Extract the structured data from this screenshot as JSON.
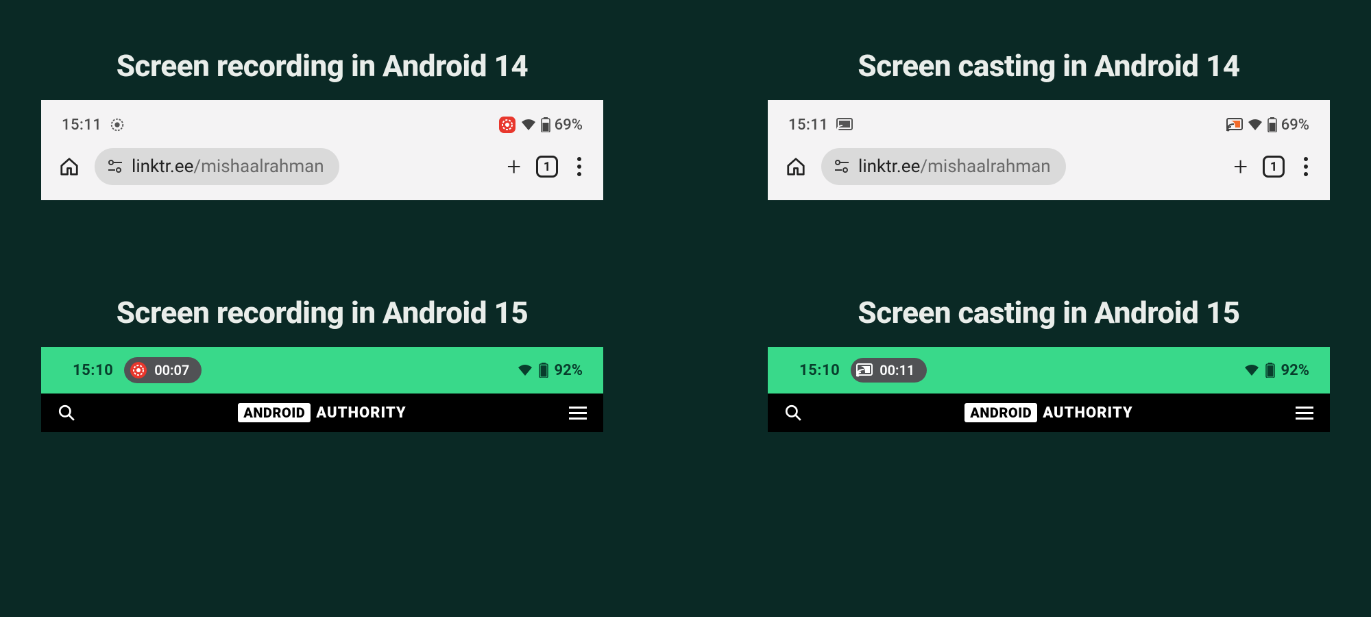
{
  "colors": {
    "bg": "#0a2925",
    "accent_red": "#e8372d",
    "accent_green": "#39d98a",
    "chip_bg": "#515255",
    "cast_orange": "#f26a2a"
  },
  "panels": {
    "rec14": {
      "title": "Screen recording in Android 14",
      "status_time": "15:11",
      "battery_pct": "69%",
      "url_domain": "linktr.ee",
      "url_path": "/mishaalrahman",
      "tab_count": "1"
    },
    "cast14": {
      "title": "Screen casting in Android 14",
      "status_time": "15:11",
      "battery_pct": "69%",
      "url_domain": "linktr.ee",
      "url_path": "/mishaalrahman",
      "tab_count": "1"
    },
    "rec15": {
      "title": "Screen recording in Android 15",
      "status_time": "15:10",
      "chip_timer": "00:07",
      "battery_pct": "92%",
      "brand_android": "ANDROID",
      "brand_authority": "AUTHORITY"
    },
    "cast15": {
      "title": "Screen casting in Android 15",
      "status_time": "15:10",
      "chip_timer": "00:11",
      "battery_pct": "92%",
      "brand_android": "ANDROID",
      "brand_authority": "AUTHORITY"
    }
  }
}
